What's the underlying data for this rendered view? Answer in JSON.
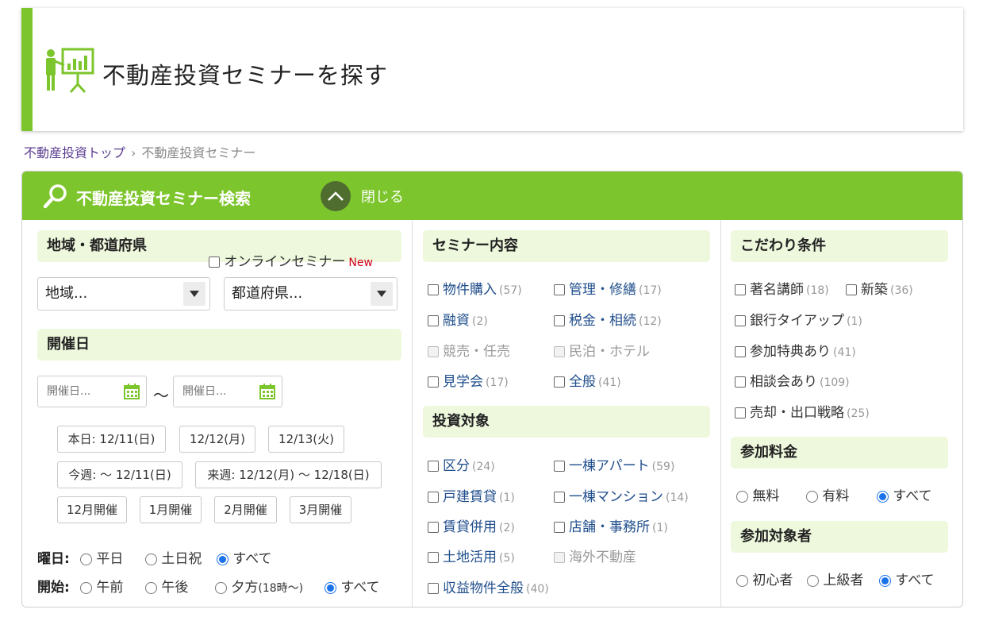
{
  "page": {
    "title": "不動産投資セミナーを探す"
  },
  "breadcrumb": {
    "home": "不動産投資トップ",
    "separator": "›",
    "current": "不動産投資セミナー"
  },
  "search_panel": {
    "title": "不動産投資セミナー検索",
    "close_label": "閉じる"
  },
  "region": {
    "heading": "地域・都道府県",
    "online_label": "オンラインセミナー",
    "online_new": "New",
    "region_select": "地域...",
    "pref_select": "都道府県..."
  },
  "date": {
    "heading": "開催日",
    "from_placeholder": "開催日...",
    "to_placeholder": "開催日...",
    "tilde": "〜",
    "quick_buttons": [
      "本日: 12/11(日)",
      "12/12(月)",
      "12/13(火)",
      "今週: 〜 12/11(日)",
      "来週: 12/12(月) 〜 12/18(日)",
      "12月開催",
      "1月開催",
      "2月開催",
      "3月開催"
    ]
  },
  "weekday": {
    "label": "曜日:",
    "options": [
      "平日",
      "土日祝",
      "すべて"
    ],
    "selected": "すべて"
  },
  "start": {
    "label": "開始:",
    "options": [
      "午前",
      "午後",
      "夕方",
      "すべて"
    ],
    "evening_note": "(18時〜)",
    "selected": "すべて"
  },
  "seminar_content": {
    "heading": "セミナー内容",
    "items": [
      {
        "label": "物件購入",
        "count": "(57)"
      },
      {
        "label": "管理・修繕",
        "count": "(17)"
      },
      {
        "label": "融資",
        "count": "(2)"
      },
      {
        "label": "税金・相続",
        "count": "(12)"
      },
      {
        "label": "競売・任売",
        "count": ""
      },
      {
        "label": "民泊・ホテル",
        "count": ""
      },
      {
        "label": "見学会",
        "count": "(17)"
      },
      {
        "label": "全般",
        "count": "(41)"
      }
    ]
  },
  "investment_target": {
    "heading": "投資対象",
    "items": [
      {
        "label": "区分",
        "count": "(24)"
      },
      {
        "label": "一棟アパート",
        "count": "(59)"
      },
      {
        "label": "戸建賃貸",
        "count": "(1)"
      },
      {
        "label": "一棟マンション",
        "count": "(14)"
      },
      {
        "label": "賃貸併用",
        "count": "(2)"
      },
      {
        "label": "店舗・事務所",
        "count": "(1)"
      },
      {
        "label": "土地活用",
        "count": "(5)"
      },
      {
        "label": "海外不動産",
        "count": ""
      },
      {
        "label": "収益物件全般",
        "count": "(40)"
      }
    ]
  },
  "conditions": {
    "heading": "こだわり条件",
    "items": [
      {
        "label": "著名講師",
        "count": "(18)"
      },
      {
        "label": "新築",
        "count": "(36)"
      },
      {
        "label": "銀行タイアップ",
        "count": "(1)"
      },
      {
        "label": "参加特典あり",
        "count": "(41)"
      },
      {
        "label": "相談会あり",
        "count": "(109)"
      },
      {
        "label": "売却・出口戦略",
        "count": "(25)"
      }
    ]
  },
  "fee": {
    "heading": "参加料金",
    "options": [
      "無料",
      "有料",
      "すべて"
    ],
    "selected": "すべて"
  },
  "audience": {
    "heading": "参加対象者",
    "options": [
      "初心者",
      "上級者",
      "すべて"
    ],
    "selected": "すべて"
  },
  "colors": {
    "accent_green": "#7dc52c",
    "section_bg": "#eef8dd",
    "link_blue": "#1f4e8c",
    "radio_blue": "#1a73e8",
    "new_red": "#d0021b"
  }
}
